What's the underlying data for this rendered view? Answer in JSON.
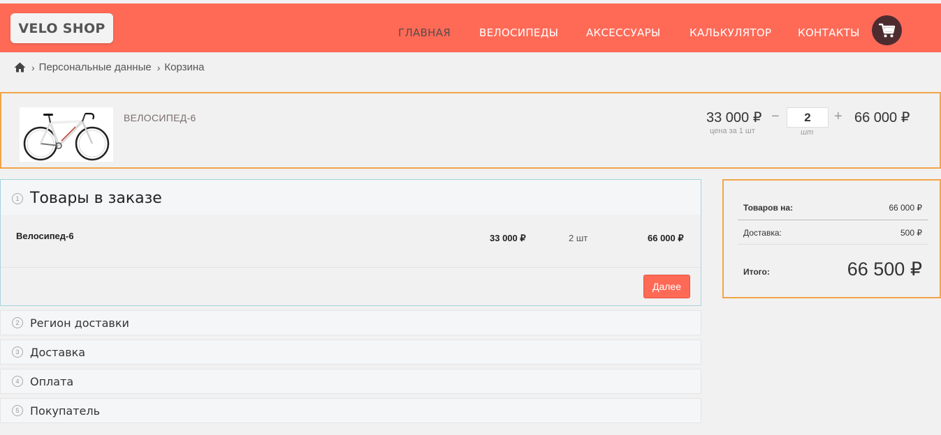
{
  "header": {
    "logo": "VELO SHOP",
    "nav": [
      "ГЛАВНАЯ",
      "ВЕЛОСИПЕДЫ",
      "АКСЕССУАРЫ",
      "КАЛЬКУЛЯТОР",
      "КОНТАКТЫ"
    ],
    "active_nav": "ГЛАВНАЯ"
  },
  "breadcrumb": [
    "Персональные данные",
    "Корзина"
  ],
  "cart_item": {
    "name": "ВЕЛОСИПЕД-6",
    "unit_price": "33 000 ₽",
    "unit_price_caption": "цена за 1 шт",
    "quantity": "2",
    "quantity_caption": "шт",
    "minus": "−",
    "plus": "+",
    "total": "66 000 ₽"
  },
  "order": {
    "step_number": "1",
    "title": "Товары в заказе",
    "item_name": "Велосипед-6",
    "item_price": "33 000 ₽",
    "item_qty": "2 шт",
    "item_total": "66 000 ₽",
    "next_label": "Далее"
  },
  "steps": [
    {
      "number": "2",
      "label": "Регион доставки"
    },
    {
      "number": "3",
      "label": "Доставка"
    },
    {
      "number": "4",
      "label": "Оплата"
    },
    {
      "number": "5",
      "label": "Покупатель"
    }
  ],
  "summary": {
    "goods_label": "Товаров на:",
    "goods_value": "66 000 ₽",
    "delivery_label": "Доставка:",
    "delivery_value": "500 ₽",
    "total_label": "Итого:",
    "total_value": "66 500 ₽"
  },
  "colors": {
    "header": "#ff6a57",
    "accent_border": "#f2a547",
    "cart_button": "#4d2c30",
    "panel_border": "#a6d3df"
  }
}
